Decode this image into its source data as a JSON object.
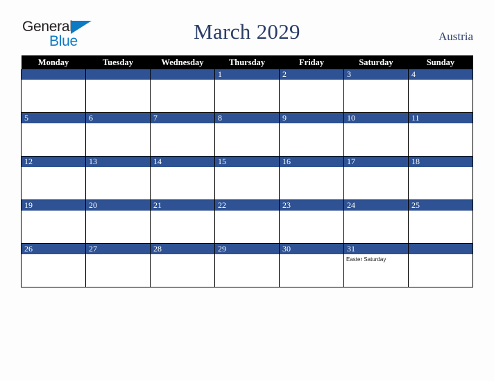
{
  "brand": {
    "word_one": "General",
    "word_two": "Blue",
    "triangle_icon": "blue-triangle-icon",
    "color_dark": "#231f20",
    "color_blue": "#0d7bc4"
  },
  "header": {
    "title": "March 2029",
    "country": "Austria",
    "title_color": "#2c3e68"
  },
  "colors": {
    "weekday_header_bg": "#000000",
    "weekday_header_text": "#ffffff",
    "daynum_band": "#2e5293",
    "daynum_text": "#ffffff",
    "cell_bg": "#ffffff",
    "page_bg": "#fdfdfd",
    "border": "#000000"
  },
  "weekdays": [
    "Monday",
    "Tuesday",
    "Wednesday",
    "Thursday",
    "Friday",
    "Saturday",
    "Sunday"
  ],
  "weeks": [
    [
      {
        "day": "",
        "events": []
      },
      {
        "day": "",
        "events": []
      },
      {
        "day": "",
        "events": []
      },
      {
        "day": "1",
        "events": []
      },
      {
        "day": "2",
        "events": []
      },
      {
        "day": "3",
        "events": []
      },
      {
        "day": "4",
        "events": []
      }
    ],
    [
      {
        "day": "5",
        "events": []
      },
      {
        "day": "6",
        "events": []
      },
      {
        "day": "7",
        "events": []
      },
      {
        "day": "8",
        "events": []
      },
      {
        "day": "9",
        "events": []
      },
      {
        "day": "10",
        "events": []
      },
      {
        "day": "11",
        "events": []
      }
    ],
    [
      {
        "day": "12",
        "events": []
      },
      {
        "day": "13",
        "events": []
      },
      {
        "day": "14",
        "events": []
      },
      {
        "day": "15",
        "events": []
      },
      {
        "day": "16",
        "events": []
      },
      {
        "day": "17",
        "events": []
      },
      {
        "day": "18",
        "events": []
      }
    ],
    [
      {
        "day": "19",
        "events": []
      },
      {
        "day": "20",
        "events": []
      },
      {
        "day": "21",
        "events": []
      },
      {
        "day": "22",
        "events": []
      },
      {
        "day": "23",
        "events": []
      },
      {
        "day": "24",
        "events": []
      },
      {
        "day": "25",
        "events": []
      }
    ],
    [
      {
        "day": "26",
        "events": []
      },
      {
        "day": "27",
        "events": []
      },
      {
        "day": "28",
        "events": []
      },
      {
        "day": "29",
        "events": []
      },
      {
        "day": "30",
        "events": []
      },
      {
        "day": "31",
        "events": [
          "Easter Saturday"
        ]
      },
      {
        "day": "",
        "events": []
      }
    ]
  ]
}
